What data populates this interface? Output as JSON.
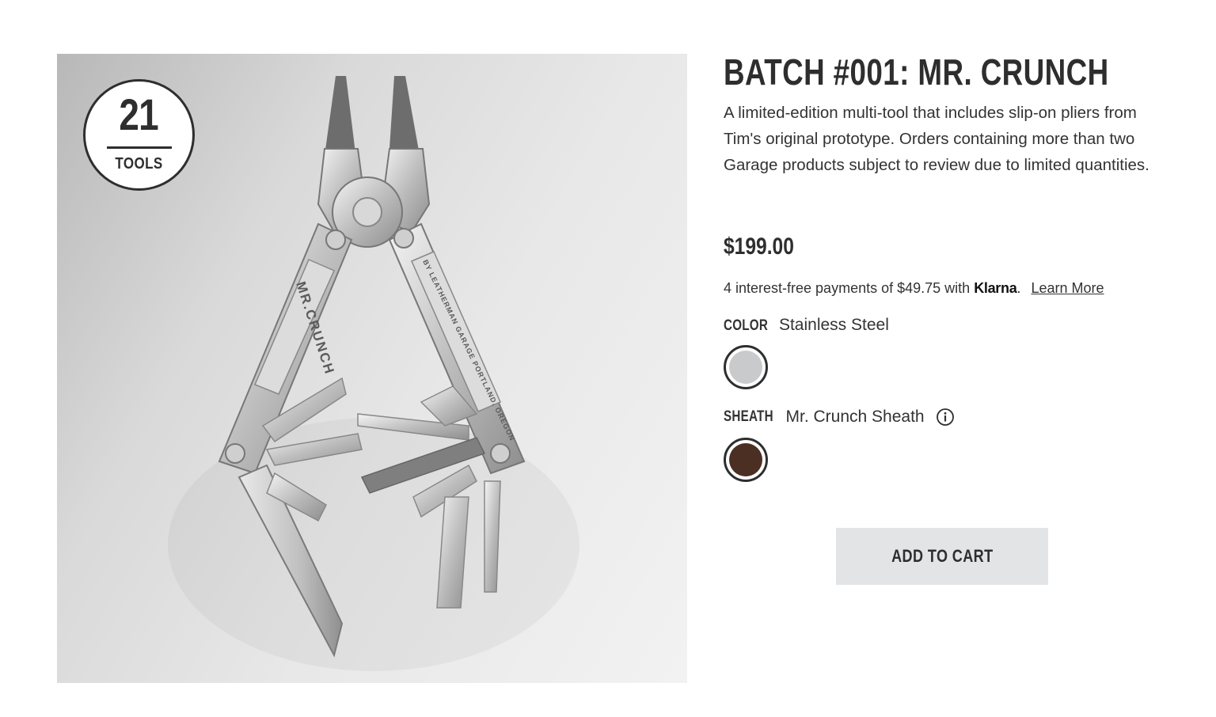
{
  "image": {
    "badge_count": "21",
    "badge_unit": "TOOLS",
    "handle_left_text": "MR.CRUNCH",
    "handle_right_text": "BY LEATHERMAN GARAGE PORTLAND, OREGON"
  },
  "product": {
    "title": "BATCH #001: MR. CRUNCH",
    "description": "A limited-edition multi-tool that includes slip-on pliers from Tim's original prototype. Orders containing more than two Garage products subject to review due to limited quantities.",
    "price": "$199.00",
    "klarna_prefix": "4 interest-free payments of $49.75 with",
    "klarna_brand": "Klarna",
    "klarna_suffix": ".",
    "learn_more": "Learn More"
  },
  "options": {
    "color_key": "COLOR",
    "color_value": "Stainless Steel",
    "color_swatch": "#c9cacc",
    "sheath_key": "SHEATH",
    "sheath_value": "Mr. Crunch Sheath",
    "sheath_swatch": "#4a2f22"
  },
  "cart": {
    "label": "ADD TO CART"
  },
  "colors": {
    "text": "#2e2e2e",
    "button_bg": "#e3e4e6"
  }
}
